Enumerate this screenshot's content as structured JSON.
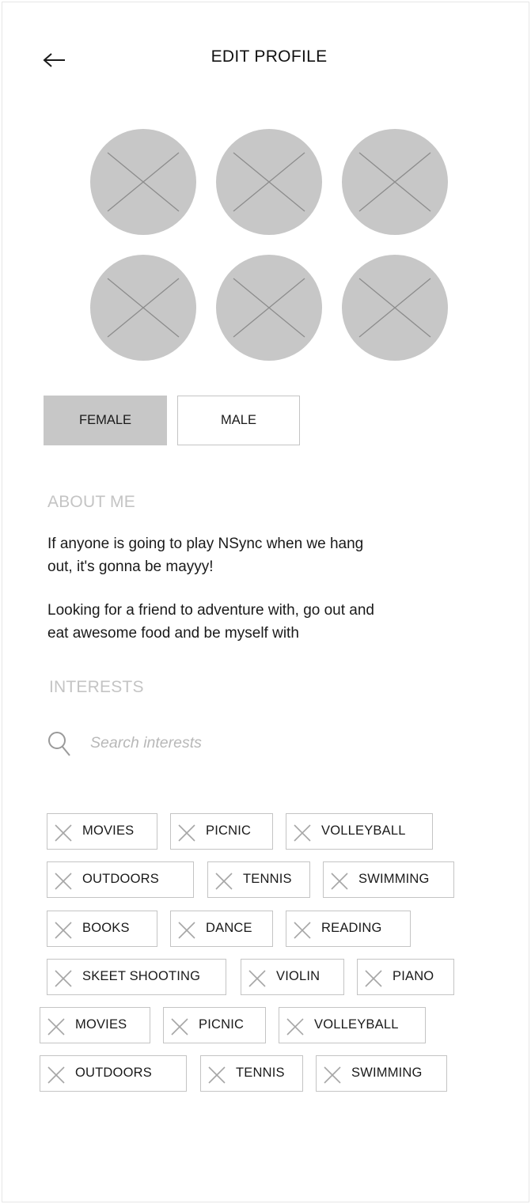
{
  "header": {
    "title": "EDIT PROFILE",
    "back_icon": "arrow-left-icon"
  },
  "photos": {
    "count": 6,
    "placeholder_icon": "image-placeholder-icon",
    "placeholder_color": "#c7c7c7"
  },
  "gender": {
    "options": [
      "FEMALE",
      "MALE"
    ],
    "selected": "FEMALE",
    "selected_color": "#c7c7c7"
  },
  "about": {
    "label": "ABOUT ME",
    "paragraph1_line1": "If anyone is going to play NSync when we hang",
    "paragraph1_line2": "out, it's gonna be mayyy!",
    "paragraph2_line1": "Looking for a friend to adventure with, go out and",
    "paragraph2_line2": "eat awesome food and be myself with"
  },
  "interests": {
    "label": "INTERESTS",
    "search_placeholder": "Search interests",
    "search_icon": "search-icon",
    "remove_icon": "close-icon",
    "chips": [
      "MOVIES",
      "PICNIC",
      "VOLLEYBALL",
      "OUTDOORS",
      "TENNIS",
      "SWIMMING",
      "BOOKS",
      "DANCE",
      "READING",
      "SKEET SHOOTING",
      "VIOLIN",
      "PIANO",
      "MOVIES",
      "PICNIC",
      "VOLLEYBALL",
      "OUTDOORS",
      "TENNIS",
      "SWIMMING"
    ]
  },
  "colors": {
    "border": "#c4c4c4",
    "muted_text": "#c4c4c4",
    "text": "#1a1a1a"
  }
}
